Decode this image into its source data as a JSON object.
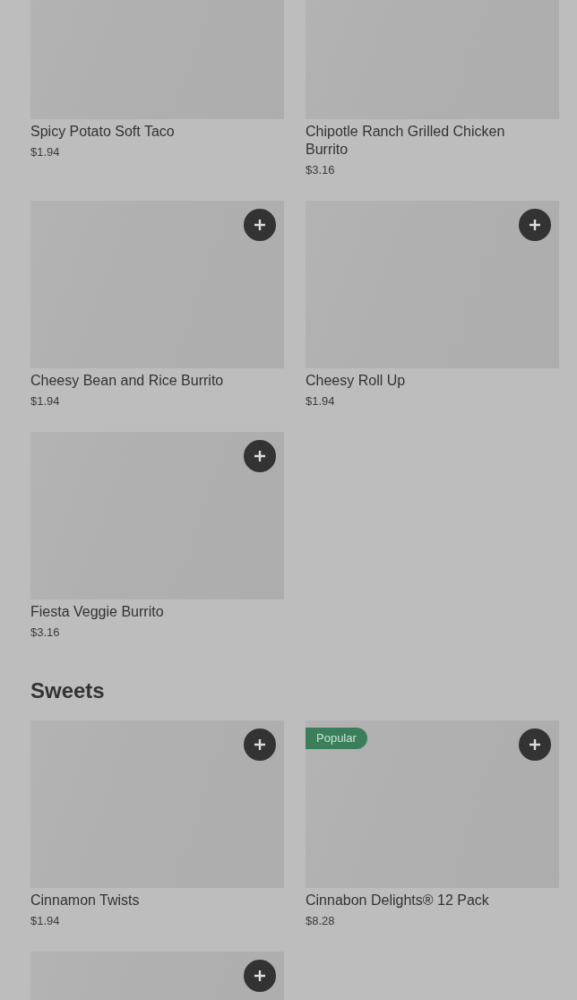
{
  "sections": [
    {
      "items": [
        {
          "name": "Spicy Potato Soft Taco",
          "price": "$1.94",
          "add_button": false
        },
        {
          "name": "Chipotle Ranch Grilled Chicken Burrito",
          "price": "$3.16",
          "add_button": false
        },
        {
          "name": "Cheesy Bean and Rice Burrito",
          "price": "$1.94",
          "add_button": true
        },
        {
          "name": "Cheesy Roll Up",
          "price": "$1.94",
          "add_button": true
        },
        {
          "name": "Fiesta Veggie Burrito",
          "price": "$3.16",
          "add_button": true
        }
      ]
    },
    {
      "title": "Sweets",
      "items": [
        {
          "name": "Cinnamon Twists",
          "price": "$1.94",
          "add_button": true
        },
        {
          "name": "Cinnabon Delights® 12 Pack",
          "price": "$8.28",
          "badge": "Popular",
          "add_button": true
        },
        {
          "add_button": true
        }
      ]
    }
  ]
}
